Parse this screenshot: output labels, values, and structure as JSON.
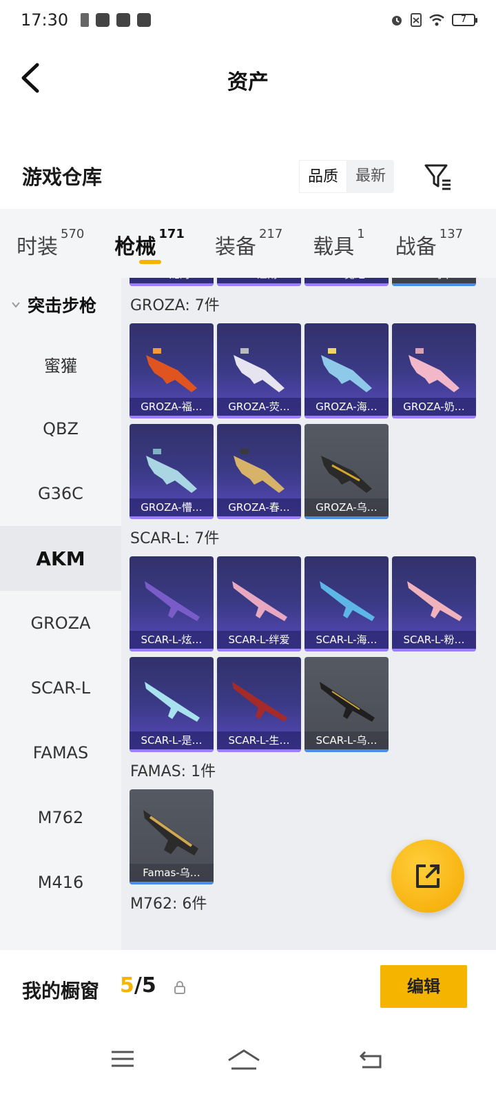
{
  "status": {
    "time": "17:30",
    "battery": "7"
  },
  "header": {
    "title": "资产"
  },
  "warehouse": {
    "title": "游戏仓库",
    "sort_quality": "品质",
    "sort_newest": "最新"
  },
  "tabs": [
    {
      "label": "时装",
      "count": "570"
    },
    {
      "label": "枪械",
      "count": "171"
    },
    {
      "label": "装备",
      "count": "217"
    },
    {
      "label": "载具",
      "count": "1"
    },
    {
      "label": "战备",
      "count": "137"
    }
  ],
  "sidebar": {
    "group": "突击步枪",
    "items": [
      "蜜獾",
      "QBZ",
      "G36C",
      "AKM",
      "GROZA",
      "SCAR-L",
      "FAMAS",
      "M762",
      "M416"
    ]
  },
  "content": {
    "akm_partial": [
      "AKM-龙的…",
      "AKM-江南…",
      "AKM-霓虹…",
      "AKM-乌木…"
    ],
    "sections": [
      {
        "title": "GROZA: 7件",
        "items": [
          "GROZA-福…",
          "GROZA-荧…",
          "GROZA-海…",
          "GROZA-奶…",
          "GROZA-懵…",
          "GROZA-春…",
          "GROZA-乌…"
        ]
      },
      {
        "title": "SCAR-L: 7件",
        "items": [
          "SCAR-L-炫…",
          "SCAR-L-绊爱",
          "SCAR-L-海…",
          "SCAR-L-粉…",
          "SCAR-L-是…",
          "SCAR-L-生…",
          "SCAR-L-乌…"
        ]
      },
      {
        "title": "FAMAS: 1件",
        "items": [
          "Famas-乌…"
        ]
      },
      {
        "title": "M762: 6件",
        "items": []
      }
    ]
  },
  "showcase": {
    "title": "我的橱窗",
    "current": "5",
    "separator": "/",
    "total": "5",
    "edit": "编辑"
  },
  "colors": {
    "accent": "#f5b400",
    "card_purple": "#3a3a86",
    "card_gray": "#4a4d55"
  }
}
